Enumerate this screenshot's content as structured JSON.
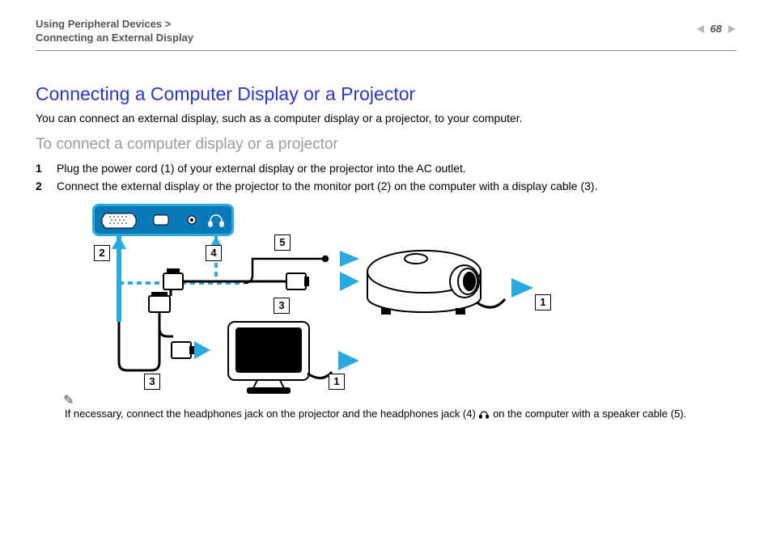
{
  "header": {
    "breadcrumb_top": "Using Peripheral Devices >",
    "breadcrumb_sub": "Connecting an External Display",
    "page_number": "68"
  },
  "title": "Connecting a Computer Display or a Projector",
  "intro": "You can connect an external display, such as a computer display or a projector, to your computer.",
  "subtitle": "To connect a computer display or a projector",
  "steps": [
    "Plug the power cord (1) of your external display or the projector into the AC outlet.",
    "Connect the external display or the projector to the monitor port (2) on the computer with a display cable (3)."
  ],
  "diagram": {
    "callouts": [
      "1",
      "2",
      "3",
      "4",
      "5"
    ],
    "description": "Computer side-panel with VGA port (2) and headphones jack (4); display cable (3) connects to monitor and projector; power cord (1) to AC; speaker cable (5) from headphones jack to projector."
  },
  "note_prefix": "If necessary, connect the headphones jack on the projector and the headphones jack (4) ",
  "note_suffix": " on the computer with a speaker cable (5)."
}
